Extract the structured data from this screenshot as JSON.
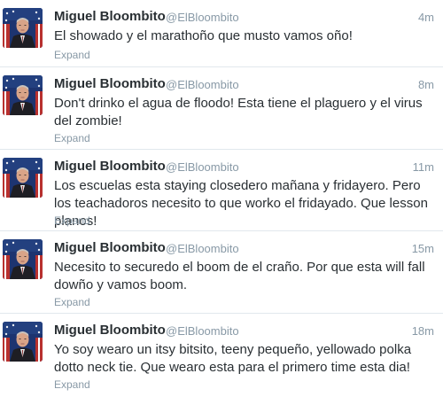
{
  "tweets": [
    {
      "name": "Miguel Bloombito",
      "handle": "@ElBloombito",
      "time": "4m",
      "text": "El showado y el marathoño que musto vamos oño!",
      "expand": "Expand"
    },
    {
      "name": "Miguel Bloombito",
      "handle": "@ElBloombito",
      "time": "8m",
      "text": "Don't drinko el agua de floodo! Esta tiene el plaguero y el virus del zombie!",
      "expand": "Expand"
    },
    {
      "name": "Miguel Bloombito",
      "handle": "@ElBloombito",
      "time": "11m",
      "text": "Los escuelas esta staying closedero mañana y fridayero. Pero los teachadoros necesito to que worko el fridayado. Que lesson planos!",
      "expand": "Expand"
    },
    {
      "name": "Miguel Bloombito",
      "handle": "@ElBloombito",
      "time": "15m",
      "text": "Necesito to securedo el boom de el craño. Por que esta will fall dowño y vamos boom.",
      "expand": "Expand"
    },
    {
      "name": "Miguel Bloombito",
      "handle": "@ElBloombito",
      "time": "18m",
      "text": "Yo soy wearo un itsy bitsito, teeny pequeño, yellowado polka dotto neck tie. Que wearo esta para el primero time esta dia!",
      "expand": "Expand"
    }
  ]
}
